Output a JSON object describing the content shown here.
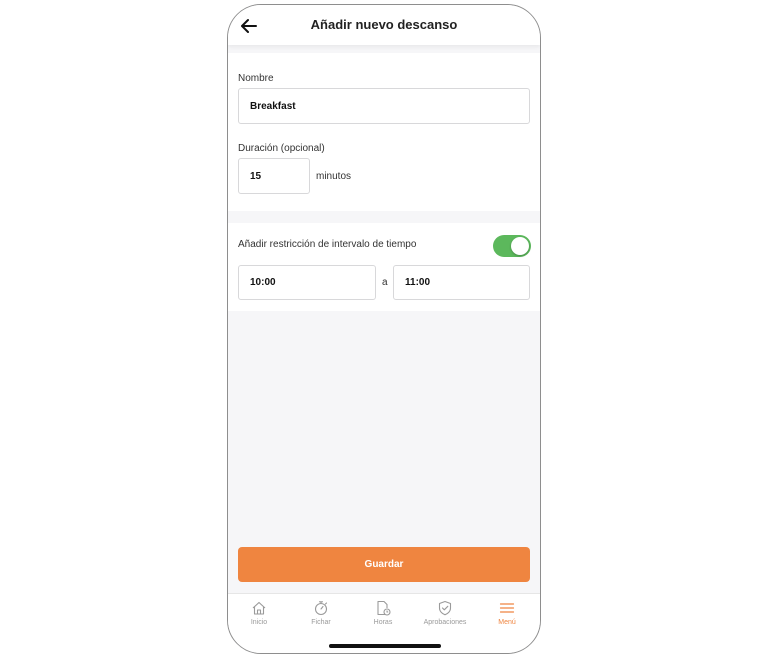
{
  "header": {
    "title": "Añadir nuevo descanso"
  },
  "form": {
    "name_label": "Nombre",
    "name_value": "Breakfast",
    "duration_label": "Duración (opcional)",
    "duration_value": "15",
    "duration_unit": "minutos",
    "restriction_label": "Añadir restricción de intervalo de tiempo",
    "restriction_enabled": true,
    "start_time": "10:00",
    "separator": "a",
    "end_time": "11:00",
    "save_label": "Guardar"
  },
  "tabbar": {
    "items": [
      {
        "label": "Inicio",
        "icon": "home-icon"
      },
      {
        "label": "Fichar",
        "icon": "stopwatch-icon"
      },
      {
        "label": "Horas",
        "icon": "timesheet-icon"
      },
      {
        "label": "Aprobaciones",
        "icon": "shield-check-icon"
      },
      {
        "label": "Menú",
        "icon": "menu-icon",
        "active": true
      }
    ]
  },
  "colors": {
    "accent": "#ef8540",
    "toggle_on": "#5cb85c"
  }
}
